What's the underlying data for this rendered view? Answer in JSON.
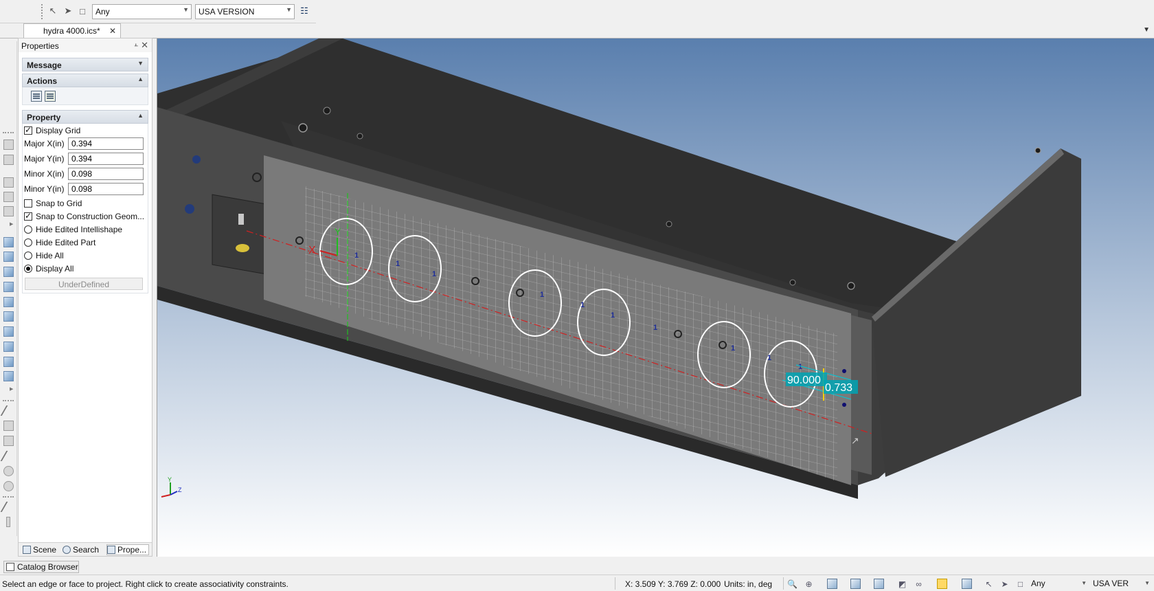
{
  "toolbar": {
    "filter_select": "Any",
    "version_select": "USA VERSION",
    "icons": [
      "select-pointer-icon",
      "pointer-icon",
      "select-box-icon",
      "tree-structure-icon"
    ]
  },
  "tabs": {
    "document": "hydra 4000.ics*"
  },
  "panel": {
    "title": "Properties",
    "sections": {
      "message": "Message",
      "actions": "Actions",
      "property": "Property"
    },
    "display_grid": {
      "label": "Display Grid",
      "checked": true
    },
    "major_x": {
      "label": "Major X(in)",
      "value": "0.394"
    },
    "major_y": {
      "label": "Major Y(in)",
      "value": "0.394"
    },
    "minor_x": {
      "label": "Minor X(in)",
      "value": "0.098"
    },
    "minor_y": {
      "label": "Minor Y(in)",
      "value": "0.098"
    },
    "snap_grid": {
      "label": "Snap to Grid",
      "checked": false
    },
    "snap_construction": {
      "label": "Snap to Construction Geom...",
      "checked": true
    },
    "radios": {
      "hide_intellishape": "Hide Edited Intellishape",
      "hide_part": "Hide Edited Part",
      "hide_all": "Hide All",
      "display_all": "Display All",
      "selected": "Display All"
    },
    "status_button": "UnderDefined",
    "bottom_tabs": {
      "scene": "Scene",
      "search": "Search",
      "properties": "Prope..."
    }
  },
  "viewport": {
    "dimension_angle": "90.000",
    "dimension_length": "0.733",
    "constraint_marker": "1",
    "axis_x": "X",
    "axis_y": "Y",
    "triad_x": "X",
    "triad_y": "Y",
    "triad_z": "Z",
    "colors": {
      "background_top": "#5a7fae",
      "background_bottom": "#ffffff",
      "part_dark": "#3a3a3a",
      "sketch_plane": "#7a7a7a",
      "dimension": "#00c8d8"
    }
  },
  "catalog_browser": "Catalog Browser",
  "statusbar": {
    "message": "Select an edge or face to project.  Right click to create associativity constraints.",
    "coords": "X: 3.509 Y: 3.769 Z: 0.000",
    "units": "Units: in, deg",
    "filter_select": "Any",
    "version_select": "USA VER"
  }
}
